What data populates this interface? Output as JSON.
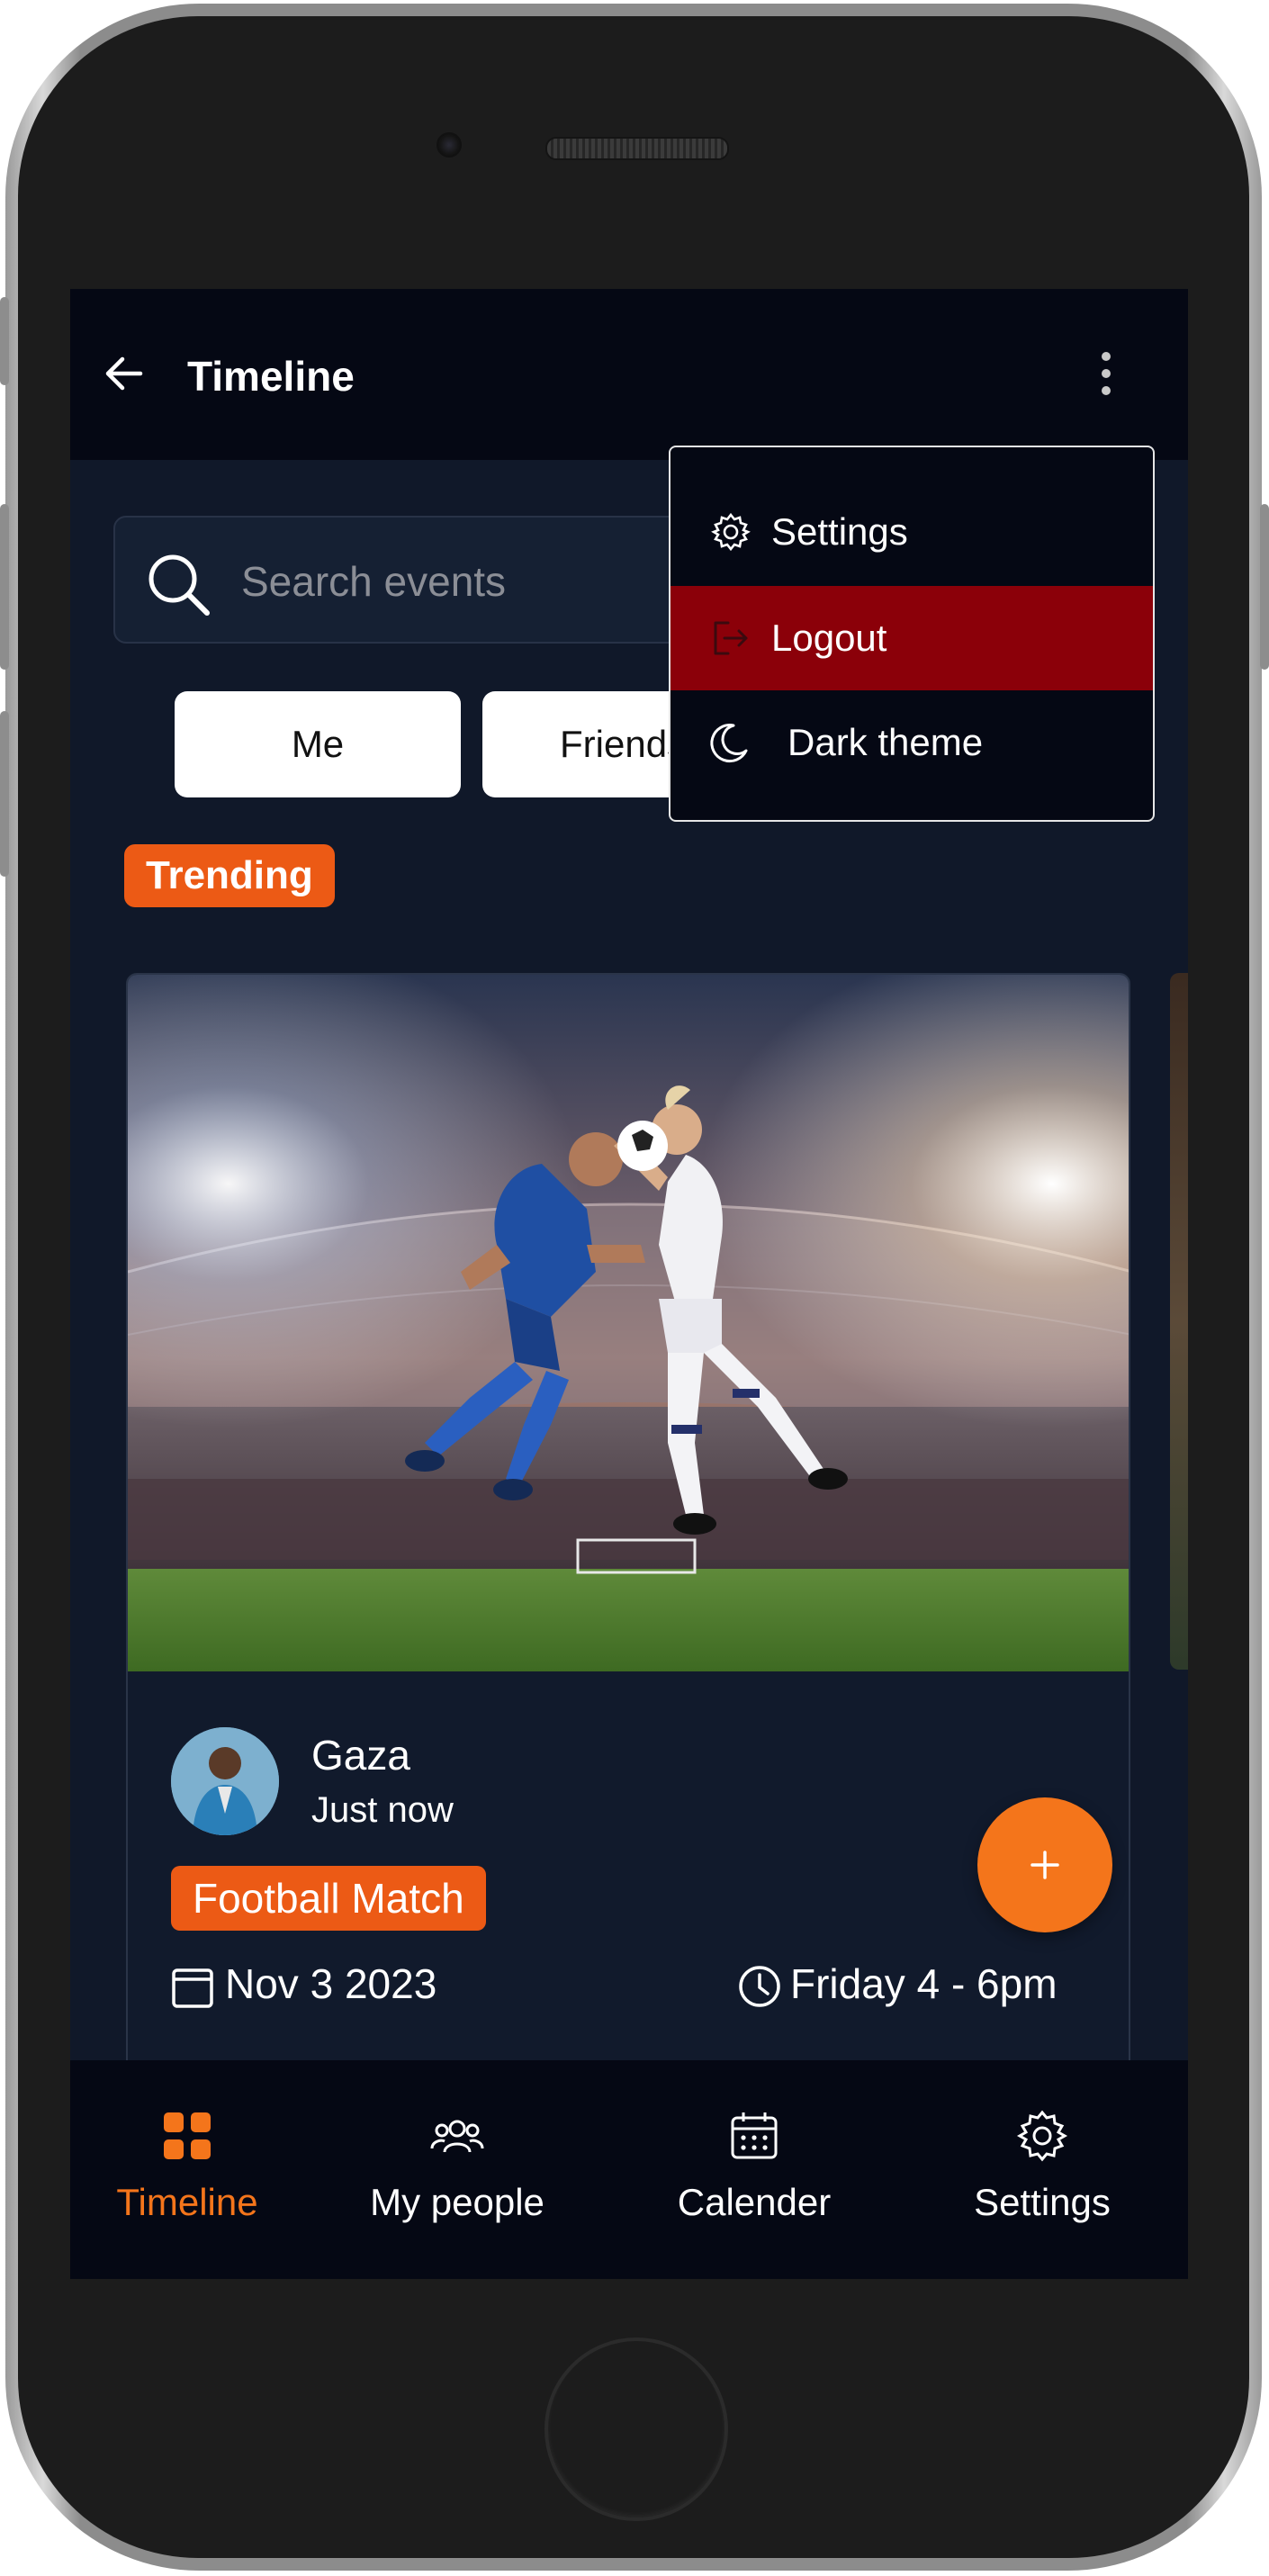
{
  "app_bar": {
    "title": "Timeline"
  },
  "search": {
    "placeholder": "Search events"
  },
  "filters": {
    "chips": [
      {
        "label": "Me"
      },
      {
        "label": "Friends"
      }
    ]
  },
  "menu": {
    "items": [
      {
        "label": "Settings",
        "icon": "gear-icon"
      },
      {
        "label": "Logout",
        "icon": "logout-icon",
        "highlighted": true
      },
      {
        "label": "Dark theme",
        "icon": "moon-icon"
      }
    ]
  },
  "trending": {
    "label": "Trending"
  },
  "event_card": {
    "image": "football-players-heading-ball-in-stadium",
    "user_name": "Gaza",
    "posted": "Just now",
    "category": "Football Match",
    "date": "Nov 3 2023",
    "time": "Friday 4 - 6pm"
  },
  "fab": {
    "label": "+"
  },
  "bottom_nav": {
    "items": [
      {
        "label": "Timeline",
        "icon": "grid-icon",
        "active": true
      },
      {
        "label": "My people",
        "icon": "people-icon"
      },
      {
        "label": "Calender",
        "icon": "calendar-icon"
      },
      {
        "label": "Settings",
        "icon": "gear-icon"
      }
    ]
  },
  "colors": {
    "accent": "#f4751b",
    "badge": "#ec5a15",
    "logout_highlight": "#8b0009",
    "background": "#101829",
    "bar": "#050814"
  }
}
